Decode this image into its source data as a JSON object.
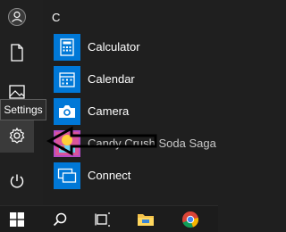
{
  "rail": {
    "items": [
      {
        "name": "user",
        "icon": "user-icon"
      },
      {
        "name": "documents",
        "icon": "document-icon"
      },
      {
        "name": "pictures",
        "icon": "pictures-icon"
      },
      {
        "name": "settings",
        "icon": "gear-icon"
      },
      {
        "name": "power",
        "icon": "power-icon"
      }
    ],
    "tooltip": "Settings"
  },
  "applist": {
    "letter": "C",
    "apps": [
      {
        "label": "Calculator",
        "icon": "calculator-icon"
      },
      {
        "label": "Calendar",
        "icon": "calendar-icon"
      },
      {
        "label": "Camera",
        "icon": "camera-icon"
      },
      {
        "label": "Candy Crush Soda Saga",
        "icon": "candy-crush-icon"
      },
      {
        "label": "Connect",
        "icon": "connect-icon"
      }
    ]
  },
  "taskbar": {
    "items": [
      {
        "name": "start",
        "icon": "windows-icon"
      },
      {
        "name": "search",
        "icon": "search-icon"
      },
      {
        "name": "task-view",
        "icon": "task-view-icon"
      },
      {
        "name": "file-explorer",
        "icon": "folder-icon"
      },
      {
        "name": "chrome",
        "icon": "chrome-icon"
      }
    ]
  },
  "colors": {
    "accent": "#0078d7",
    "background": "#1f1f1f"
  }
}
